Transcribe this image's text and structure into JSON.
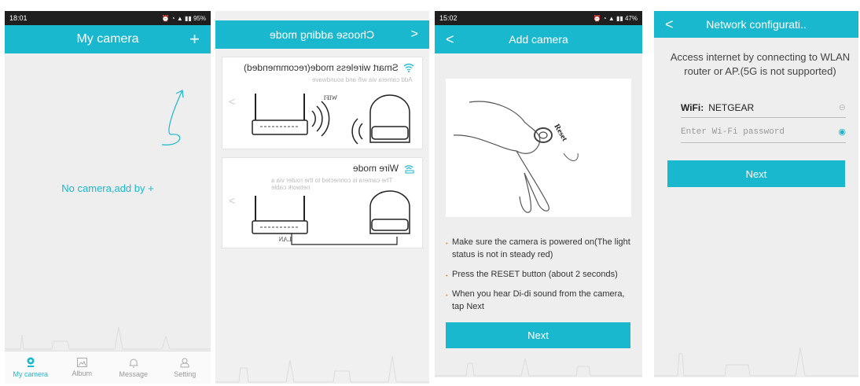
{
  "screen1": {
    "status_time": "18:01",
    "status_right": "95%",
    "title": "My camera",
    "add_icon": "plus-icon",
    "empty_text": "No camera,add by +",
    "tabs": [
      {
        "label": "My camera",
        "icon": "camera-icon",
        "active": true
      },
      {
        "label": "Album",
        "icon": "image-icon",
        "active": false
      },
      {
        "label": "Message",
        "icon": "bell-icon",
        "active": false
      },
      {
        "label": "Setting",
        "icon": "user-icon",
        "active": false
      }
    ]
  },
  "screen2": {
    "title": "Choose adding mode",
    "wifi_mode": {
      "title": "Smart wireless mode(recommended)",
      "subtitle": "Add camera via wifi and soundwave",
      "router_label": "WIFI"
    },
    "wire_mode": {
      "title": "Wire mode",
      "subtitle": "The camera is connected to the router via a network cable",
      "router_label": "LAN"
    }
  },
  "screen3": {
    "status_time": "15:02",
    "status_right": "47%",
    "title": "Add camera",
    "reset_label": "Reset",
    "steps": [
      "Make sure the camera is powered on(The light status is not in steady red)",
      "Press the RESET button (about 2 seconds)",
      "When you hear Di-di sound from the camera, tap Next"
    ],
    "next_label": "Next"
  },
  "screen4": {
    "title": "Network configurati..",
    "description": "Access internet by connecting to WLAN router or AP.(5G is not supported)",
    "wifi_label": "WiFi:",
    "wifi_value": "NETGEAR",
    "password_placeholder": "Enter Wi-Fi password",
    "next_label": "Next"
  },
  "colors": {
    "accent": "#1ab8cf",
    "statusbar": "#1f1f1f",
    "background": "#eeeeee"
  }
}
